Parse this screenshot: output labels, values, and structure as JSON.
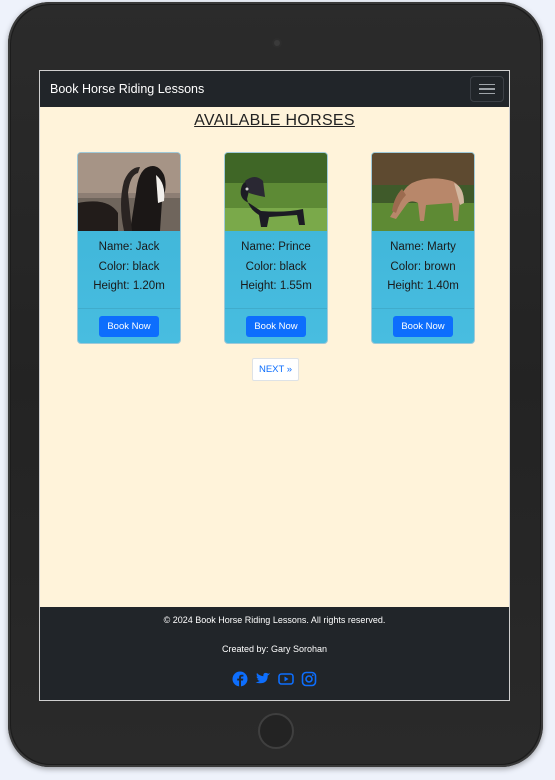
{
  "navbar": {
    "brand": "Book Horse Riding Lessons",
    "toggler_icon": "hamburger-icon"
  },
  "page": {
    "title": "AVAILABLE HORSES"
  },
  "horses": [
    {
      "name_line": "Name: Jack",
      "color_line": "Color: black",
      "height_line": "Height: 1.20m",
      "button": "Book Now"
    },
    {
      "name_line": "Name: Prince",
      "color_line": "Color: black",
      "height_line": "Height: 1.55m",
      "button": "Book Now"
    },
    {
      "name_line": "Name: Marty",
      "color_line": "Color: brown",
      "height_line": "Height: 1.40m",
      "button": "Book Now"
    }
  ],
  "pagination": {
    "next_label": "NEXT »"
  },
  "footer": {
    "copyright": "© 2024 Book Horse Riding Lessons. All rights reserved.",
    "credits": "Created by: Gary Sorohan",
    "social_icons": [
      "facebook-icon",
      "twitter-icon",
      "youtube-icon",
      "instagram-icon"
    ]
  },
  "colors": {
    "page_background": "#fff3da",
    "navbar": "#212529",
    "card": "#45b9dc",
    "button": "#0d6efd",
    "social": "#0d6efd"
  }
}
